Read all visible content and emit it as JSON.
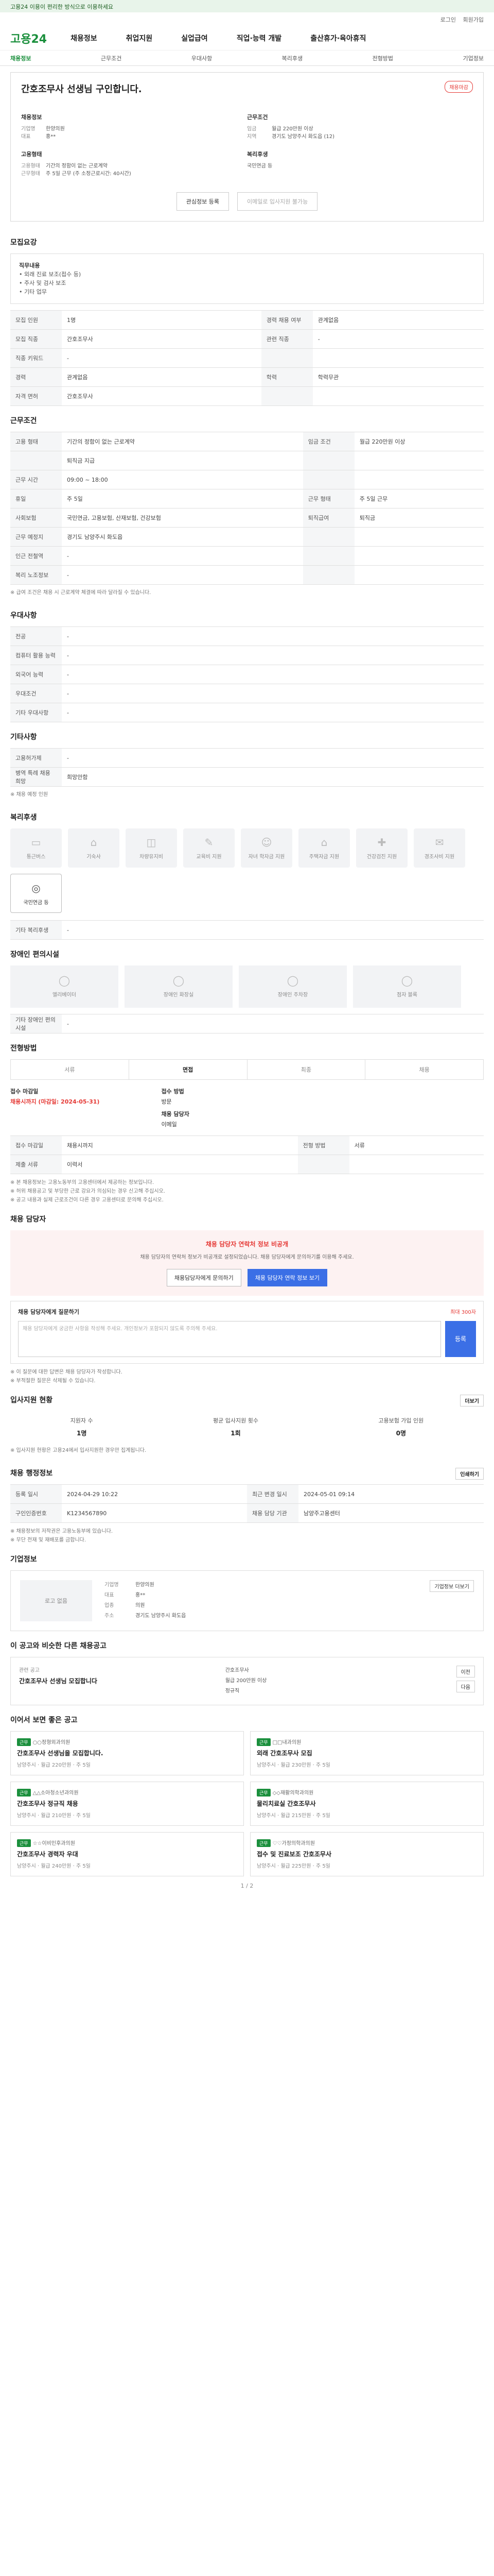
{
  "top_banner": "고용24 이용이 편리한 방식으로 이용하세요",
  "util": [
    "로그인",
    "회원가입"
  ],
  "header": {
    "logo": "고용24",
    "nav": [
      "채용정보",
      "취업지원",
      "실업급여",
      "직업·능력 개발",
      "출산휴가·육아휴직"
    ]
  },
  "subnav": [
    "채용정보",
    "근무조건",
    "우대사항",
    "복리후생",
    "전형방법",
    "기업정보"
  ],
  "job": {
    "badge": "채용마감",
    "title": "간호조무사 선생님 구인합니다.",
    "left_label": "채용정보",
    "left": [
      {
        "k": "기업명",
        "v": "한양의원"
      },
      {
        "k": "대표",
        "v": "홍**"
      }
    ],
    "right_label": "근무조건",
    "right": [
      {
        "k": "임금",
        "v": "월급 220만원 이상"
      },
      {
        "k": "지역",
        "v": "경기도 남양주시 화도읍 (12)"
      }
    ],
    "left2_label": "고용형태",
    "left2": [
      {
        "k": "고용형태",
        "v": "기간의 정함이 없는 근로계약"
      },
      {
        "k": "근무형태",
        "v": "주 5일 근무 (주 소정근로시간: 40시간)"
      }
    ],
    "right2_label": "복리후생",
    "right2": [
      {
        "k": "",
        "v": "국민연금 등"
      }
    ],
    "buttons": [
      "관심정보 등록",
      "이메일로 입사지원 불가능"
    ]
  },
  "recruit": {
    "head": "모집요강",
    "duty_label": "직무내용",
    "duties": [
      "• 외래 진료 보조(접수 등)",
      "• 주사 및 검사 보조",
      "• 기타 업무"
    ],
    "rows": [
      {
        "k": "모집 인원",
        "v": "1명",
        "k2": "경력 채용 여부",
        "v2": "관계없음"
      },
      {
        "k": "모집 직종",
        "v": "간호조무사",
        "k2": "관련 직종",
        "v2": "-"
      },
      {
        "k": "직종 키워드",
        "v": "-",
        "k2": "",
        "v2": ""
      },
      {
        "k": "경력",
        "v": "관계없음",
        "k2": "학력",
        "v2": "학력무관"
      },
      {
        "k": "자격 면허",
        "v": "간호조무사",
        "k2": "",
        "v2": ""
      }
    ]
  },
  "conditions": {
    "head": "근무조건",
    "rows": [
      {
        "k": "고용 형태",
        "v": "기간의 정함이 없는 근로계약",
        "k2": "임금 조건",
        "v2": "월급 220만원 이상"
      },
      {
        "k": "",
        "v": "퇴직금 지급",
        "k2": "",
        "v2": ""
      },
      {
        "k": "근무 시간",
        "v": "09:00 ~ 18:00",
        "k2": "",
        "v2": ""
      },
      {
        "k": "휴일",
        "v": "주 5일",
        "k2": "근무 형태",
        "v2": "주 5일 근무"
      },
      {
        "k": "사회보험",
        "v": "국민연금, 고용보험, 산재보험, 건강보험",
        "k2": "퇴직급여",
        "v2": "퇴직금"
      },
      {
        "k": "근무 예정지",
        "v": "경기도 남양주시 화도읍",
        "k2": "",
        "v2": ""
      },
      {
        "k": "인근 전철역",
        "v": "-",
        "k2": "",
        "v2": ""
      },
      {
        "k": "복리 노조정보",
        "v": "-",
        "k2": "",
        "v2": ""
      }
    ],
    "note": "※ 급여 조건은 채용 시 근로계약 체결에 따라 달라질 수 있습니다."
  },
  "preferred": {
    "head": "우대사항",
    "rows": [
      {
        "k": "전공",
        "v": "-"
      },
      {
        "k": "컴퓨터 활용 능력",
        "v": "-"
      },
      {
        "k": "외국어 능력",
        "v": "-"
      },
      {
        "k": "우대조건",
        "v": "-"
      },
      {
        "k": "기타 우대사항",
        "v": "-"
      }
    ]
  },
  "other": {
    "head": "기타사항",
    "rows": [
      {
        "k": "고용허가제",
        "v": "-"
      },
      {
        "k": "병역 특례 채용 희망",
        "v": "희망안함"
      }
    ],
    "note": "※ 채용 예정 인원"
  },
  "welfare": {
    "head": "복리후생",
    "items": [
      {
        "label": "통근버스",
        "icon": "bus-icon",
        "on": false
      },
      {
        "label": "기숙사",
        "icon": "dorm-icon",
        "on": false
      },
      {
        "label": "차량유지비",
        "icon": "car-icon",
        "on": false
      },
      {
        "label": "교육비 지원",
        "icon": "edu-icon",
        "on": false
      },
      {
        "label": "자녀 학자금 지원",
        "icon": "child-icon",
        "on": false
      },
      {
        "label": "주택자금 지원",
        "icon": "house-icon",
        "on": false
      },
      {
        "label": "건강검진 지원",
        "icon": "health-icon",
        "on": false
      },
      {
        "label": "경조사비 지원",
        "icon": "gift-icon",
        "on": false
      },
      {
        "label": "국민연금 등",
        "icon": "pension-icon",
        "on": true
      }
    ],
    "extra_label": "기타 복리후생",
    "extra_value": "-"
  },
  "disability": {
    "head": "장애인 편의시설",
    "items": [
      "엘리베이터",
      "장애인 화장실",
      "장애인 주차장",
      "점자 블록"
    ],
    "extra_label": "기타 장애인 편의시설",
    "extra_value": "-"
  },
  "method": {
    "head": "전형방법",
    "rows": [
      {
        "k": "접수 마감일",
        "v": "채용시까지",
        "k2": "전형 방법",
        "v2": "서류"
      },
      {
        "k": "제출 서류",
        "v": "이력서",
        "k2": "",
        "v2": ""
      }
    ],
    "steps": [
      "서류",
      "면접",
      "최종",
      "채용"
    ],
    "step_on": 1,
    "deadline_label": "접수 마감일",
    "deadline_value": "채용시까지 (마감일: 2024-05-31)",
    "apply_label": "접수 방법",
    "apply_value": "방문",
    "contact_label": "채용 담당자",
    "contact_value": "이메일",
    "notes": [
      "※ 본 채용정보는 고용노동부의 고용센터에서 제공하는 정보입니다.",
      "※ 허위 채용공고 및 부당한 근로 강요가 의심되는 경우 신고해 주십시오.",
      "※ 공고 내용과 실제 근로조건이 다른 경우 고용센터로 문의해 주십시오."
    ]
  },
  "manager": {
    "head": "채용 담당자",
    "warn": "채용 담당자 연락처 정보 비공개",
    "sub": "채용 담당자의 연락처 정보가 비공개로 설정되었습니다. 채용 담당자에게 문의하기를 이용해 주세요.",
    "btns": [
      "채용담당자에게 문의하기",
      "채용 담당자 연락 정보 보기"
    ],
    "ask_label": "채용 담당자에게 질문하기",
    "ask_limit": "최대 300자",
    "ask_placeholder": "채용 담당자에게 궁금한 사항을 작성해 주세요. 개인정보가 포함되지 않도록 주의해 주세요.",
    "ask_btn": "등록",
    "ask_notes": [
      "※ 이 질문에 대한 답변은 채용 담당자가 작성합니다.",
      "※ 부적절한 질문은 삭제될 수 있습니다."
    ]
  },
  "stats": {
    "head": "입사지원 현황",
    "more": "더보기",
    "items": [
      {
        "k": "지원자 수",
        "v": "1명"
      },
      {
        "k": "평균 입사지원 횟수",
        "v": "1회"
      },
      {
        "k": "고용보험 가입 인원",
        "v": "0명"
      }
    ],
    "note": "※ 입사지원 현황은 고용24에서 입사지원한 경우만 집계됩니다."
  },
  "admin": {
    "head": "채용 행정정보",
    "print": "인쇄하기",
    "rows": [
      {
        "k": "등록 일시",
        "v": "2024-04-29 10:22",
        "k2": "최근 변경 일시",
        "v2": "2024-05-01 09:14"
      },
      {
        "k": "구인인증번호",
        "v": "K1234567890",
        "k2": "채용 담당 기관",
        "v2": "남양주고용센터"
      }
    ],
    "notes": [
      "※ 채용정보의 저작권은 고용노동부에 있습니다.",
      "※ 무단 전재 및 재배포를 금합니다."
    ]
  },
  "company": {
    "head": "기업정보",
    "logo": "로고 없음",
    "info_btn": "기업정보 더보기",
    "rows": [
      {
        "k": "기업명",
        "v": "한양의원"
      },
      {
        "k": "대표",
        "v": "홍**"
      },
      {
        "k": "업종",
        "v": "의원"
      },
      {
        "k": "주소",
        "v": "경기도 남양주시 화도읍"
      }
    ]
  },
  "similar": {
    "head": "이 공고와 비슷한 다른 채용공고",
    "card_head": "관련 공고",
    "card_title": "간호조무사 선생님 모집합니다",
    "tags": [
      "간호조무사",
      "월급 200만원 이상",
      "정규직"
    ],
    "btns": [
      "이전",
      "다음"
    ]
  },
  "recommend": {
    "head": "이어서 보면 좋은 공고",
    "cards": [
      {
        "co": "○○정형외과의원",
        "t": "간호조무사 선생님을 모집합니다.",
        "m": "남양주시 · 월급 220만원 · 주 5일",
        "tag": "근무"
      },
      {
        "co": "□□내과의원",
        "t": "외래 간호조무사 모집",
        "m": "남양주시 · 월급 230만원 · 주 5일",
        "tag": "근무"
      },
      {
        "co": "△△소아청소년과의원",
        "t": "간호조무사 정규직 채용",
        "m": "남양주시 · 월급 210만원 · 주 5일",
        "tag": "근무"
      },
      {
        "co": "◇◇재활의학과의원",
        "t": "물리치료실 간호조무사",
        "m": "남양주시 · 월급 215만원 · 주 5일",
        "tag": "근무"
      },
      {
        "co": "☆☆이비인후과의원",
        "t": "간호조무사 경력자 우대",
        "m": "남양주시 · 월급 240만원 · 주 5일",
        "tag": "근무"
      },
      {
        "co": "♡♡가정의학과의원",
        "t": "접수 및 진료보조 간호조무사",
        "m": "남양주시 · 월급 225만원 · 주 5일",
        "tag": "근무"
      }
    ],
    "pager": "1 / 2"
  }
}
